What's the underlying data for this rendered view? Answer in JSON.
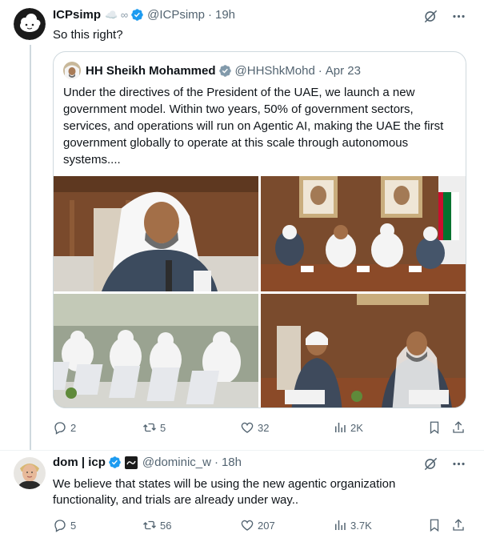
{
  "tweet1": {
    "display_name": "ICPsimp",
    "name_badges": "☁️ ∞",
    "handle": "@ICPsimp",
    "separator": "·",
    "time": "19h",
    "text": "So this right?",
    "quote": {
      "display_name": "HH Sheikh Mohammed",
      "handle": "@HHShkMohd",
      "separator": "·",
      "date": "Apr 23",
      "text": "Under the directives of the President of the UAE, we launch a new government model. Within two years, 50% of government sectors, services, and operations will run on Agentic AI, making the UAE the first government globally to operate at this scale through autonomous systems...."
    },
    "actions": {
      "replies": "2",
      "reposts": "5",
      "likes": "32",
      "views": "2K"
    }
  },
  "tweet2": {
    "display_name": "dom | icp",
    "handle": "@dominic_w",
    "separator": "·",
    "time": "18h",
    "text": "We believe that states will be using the new agentic organization functionality, and trials are already under way..",
    "actions": {
      "replies": "5",
      "reposts": "56",
      "likes": "207",
      "views": "3.7K"
    }
  },
  "colors": {
    "verified": "#1d9bf0",
    "muted": "#536471",
    "border": "#cfd9de"
  }
}
